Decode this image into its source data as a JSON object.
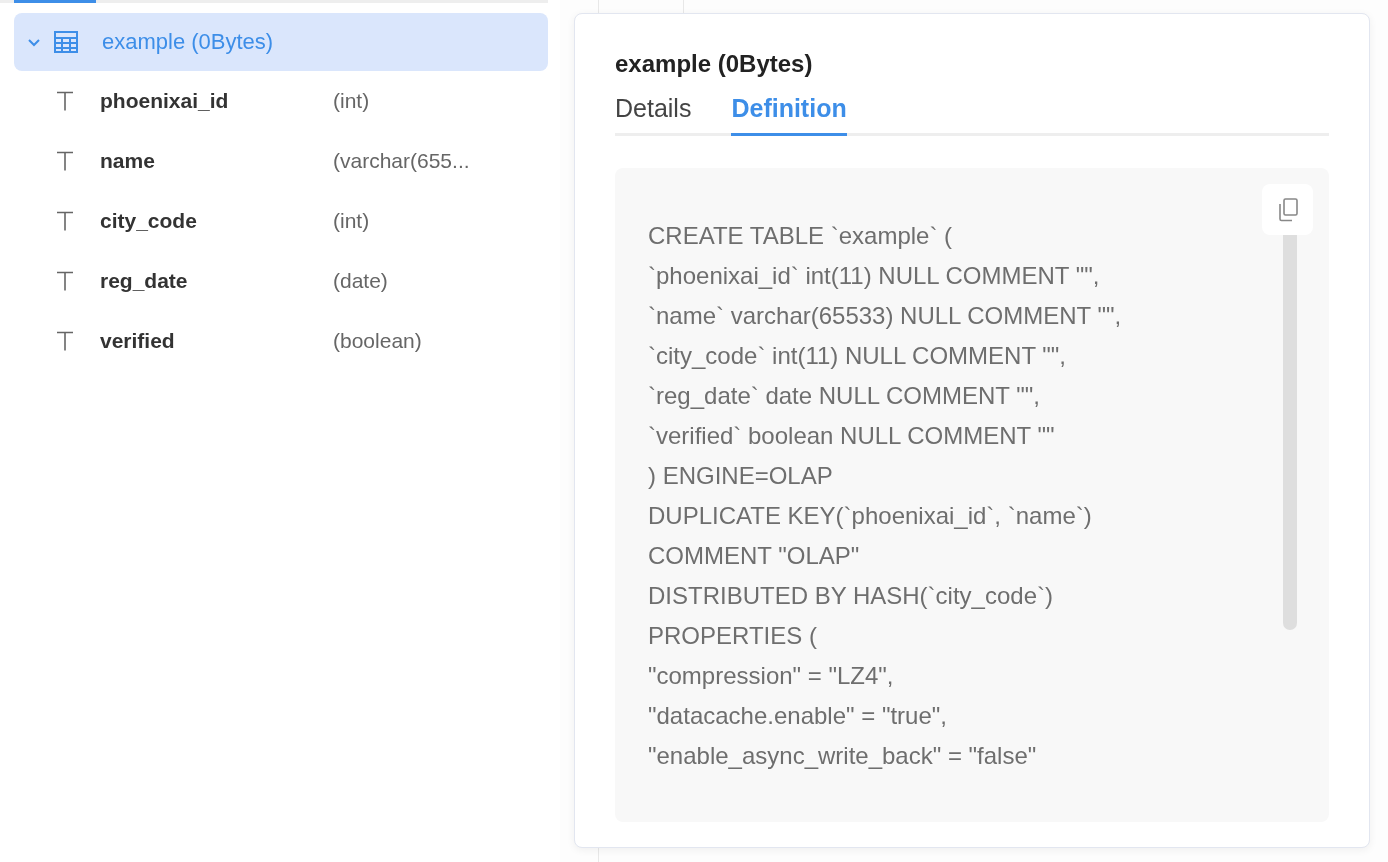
{
  "tree": {
    "label": "example (0Bytes)",
    "expanded": true,
    "selected": true,
    "children": [
      {
        "name": "phoenixai_id",
        "type": "(int)"
      },
      {
        "name": "name",
        "type": "(varchar(655..."
      },
      {
        "name": "city_code",
        "type": "(int)"
      },
      {
        "name": "reg_date",
        "type": "(date)"
      },
      {
        "name": "verified",
        "type": "(boolean)"
      }
    ]
  },
  "popover": {
    "title": "example (0Bytes)",
    "tabs": [
      {
        "label": "Details",
        "selected": false
      },
      {
        "label": "Definition",
        "selected": true
      }
    ],
    "definition": [
      "CREATE TABLE `example` (",
      "`phoenixai_id` int(11) NULL COMMENT \"\",",
      "`name` varchar(65533) NULL COMMENT \"\",",
      "`city_code` int(11) NULL COMMENT \"\",",
      "`reg_date` date NULL COMMENT \"\",",
      "`verified` boolean NULL COMMENT \"\"",
      ") ENGINE=OLAP",
      "DUPLICATE KEY(`phoenixai_id`, `name`)",
      "COMMENT \"OLAP\"",
      "DISTRIBUTED BY HASH(`city_code`)",
      "PROPERTIES (",
      "\"compression\" = \"LZ4\",",
      "\"datacache.enable\" = \"true\",",
      "\"enable_async_write_back\" = \"false\""
    ]
  }
}
